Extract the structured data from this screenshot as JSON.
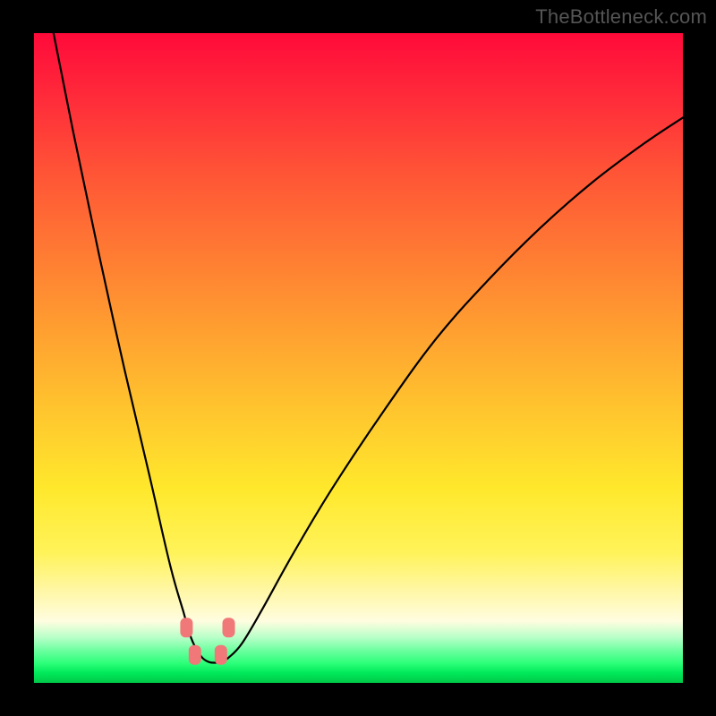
{
  "watermark": "TheBottleneck.com",
  "colors": {
    "frame": "#000000",
    "gradient_top": "#ff0a3a",
    "gradient_bottom": "#00c948",
    "curve_stroke": "#000000",
    "marker_fill": "#f07878"
  },
  "chart_data": {
    "type": "line",
    "title": "",
    "xlabel": "",
    "ylabel": "",
    "xlim": [
      0,
      100
    ],
    "ylim": [
      0,
      100
    ],
    "series": [
      {
        "name": "bottleneck-curve",
        "x": [
          3,
          6,
          10,
          14,
          18,
          21,
          23,
          24,
          25,
          26,
          27,
          28,
          29,
          30,
          32,
          35,
          40,
          46,
          54,
          62,
          70,
          78,
          86,
          94,
          100
        ],
        "y": [
          100,
          85,
          66,
          48,
          31,
          18,
          11,
          7.5,
          5.2,
          3.8,
          3.2,
          3.1,
          3.3,
          3.9,
          6.0,
          11,
          20,
          30,
          42,
          53,
          62,
          70,
          77,
          83,
          87
        ]
      }
    ],
    "markers": [
      {
        "x": 23.5,
        "y": 8.5
      },
      {
        "x": 30.0,
        "y": 8.5
      },
      {
        "x": 24.8,
        "y": 4.3
      },
      {
        "x": 28.8,
        "y": 4.3
      }
    ]
  }
}
